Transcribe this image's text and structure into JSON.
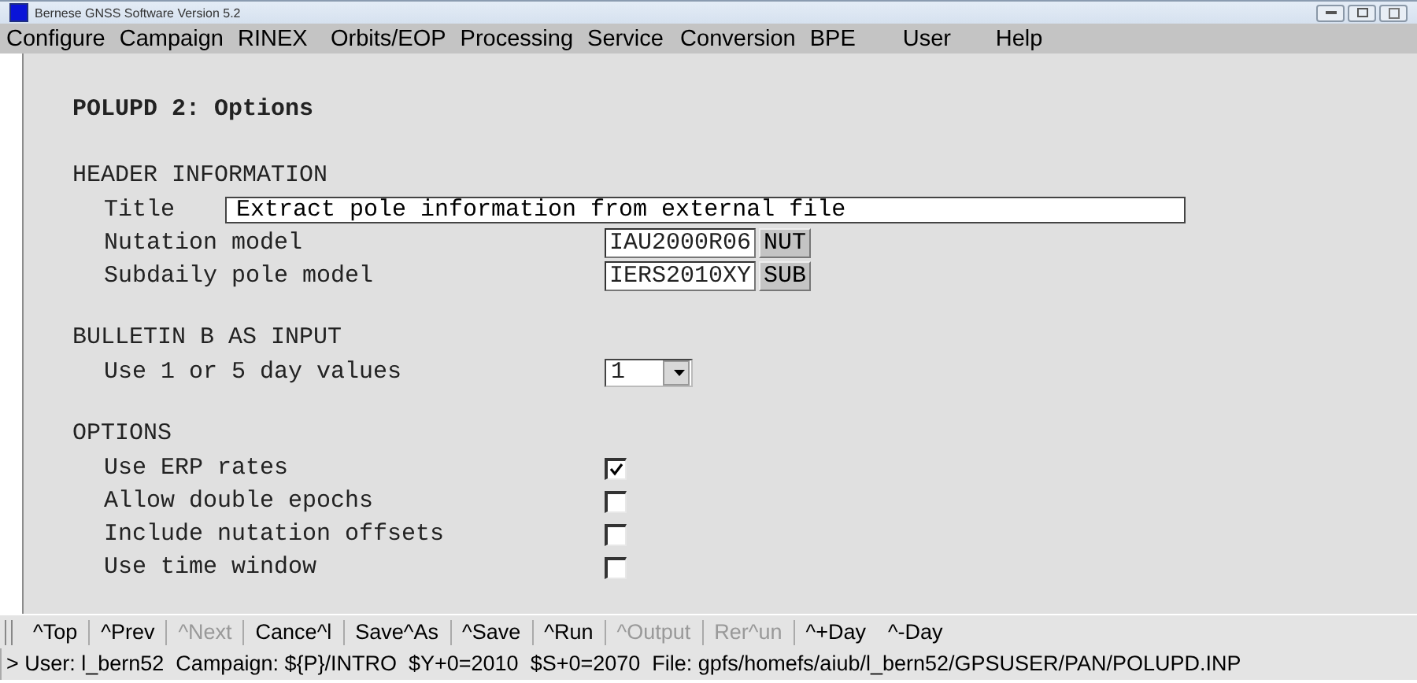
{
  "window": {
    "title": "Bernese GNSS Software Version 5.2"
  },
  "menu": [
    "Configure",
    "Campaign",
    "RINEX",
    "Orbits/EOP",
    "Processing",
    "Service",
    "Conversion",
    "BPE",
    "User",
    "Help"
  ],
  "panel": {
    "title": "POLUPD 2: Options",
    "sections": [
      {
        "heading": "HEADER INFORMATION",
        "fields": [
          {
            "kind": "text",
            "label": "Title",
            "value": "Extract pole information from external file"
          },
          {
            "kind": "choose",
            "label": "Nutation model",
            "value": "IAU2000R06",
            "button": "NUT"
          },
          {
            "kind": "choose",
            "label": "Subdaily pole model",
            "value": "IERS2010XY",
            "button": "SUB"
          }
        ]
      },
      {
        "heading": "BULLETIN B AS INPUT",
        "fields": [
          {
            "kind": "dropdown",
            "label": "Use 1 or 5 day values",
            "value": "1"
          }
        ]
      },
      {
        "heading": "OPTIONS",
        "fields": [
          {
            "kind": "checkbox",
            "label": "Use ERP rates",
            "checked": true
          },
          {
            "kind": "checkbox",
            "label": "Allow double epochs",
            "checked": false
          },
          {
            "kind": "checkbox",
            "label": "Include nutation offsets",
            "checked": false
          },
          {
            "kind": "checkbox",
            "label": "Use time window",
            "checked": false
          }
        ]
      }
    ]
  },
  "toolbar": [
    {
      "label": "^Top",
      "disabled": false,
      "separated": false
    },
    {
      "label": "^Prev",
      "disabled": false,
      "separated": true
    },
    {
      "label": "^Next",
      "disabled": true,
      "separated": true
    },
    {
      "label": "Cance^l",
      "disabled": false,
      "separated": true
    },
    {
      "label": "Save^As",
      "disabled": false,
      "separated": true
    },
    {
      "label": "^Save",
      "disabled": false,
      "separated": true
    },
    {
      "label": "^Run",
      "disabled": false,
      "separated": true
    },
    {
      "label": "^Output",
      "disabled": true,
      "separated": true
    },
    {
      "label": "Rer^un",
      "disabled": true,
      "separated": true
    },
    {
      "label": "^+Day",
      "disabled": false,
      "separated": true
    },
    {
      "label": "^-Day",
      "disabled": false,
      "separated": false
    }
  ],
  "status_bar": "> User: l_bern52  Campaign: ${P}/INTRO  $Y+0=2010  $S+0=2070  File: gpfs/homefs/aiub/l_bern52/GPSUSER/PAN/POLUPD.INP"
}
